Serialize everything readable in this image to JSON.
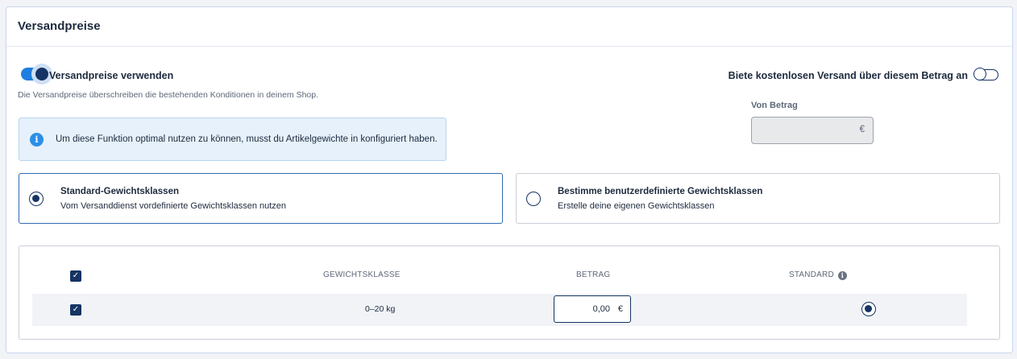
{
  "header": {
    "title": "Versandpreise"
  },
  "shipping_toggle": {
    "label": "Versandpreise verwenden",
    "description": "Die Versandpreise überschreiben die bestehenden Konditionen in deinem Shop.",
    "enabled": true
  },
  "info": {
    "icon": "info-icon",
    "text": "Um diese Funktion optimal nutzen zu können, musst du Artikelgewichte in konfiguriert haben."
  },
  "free_shipping": {
    "label": "Biete kostenlosen Versand über diesem Betrag an",
    "enabled": false,
    "from_label": "Von Betrag",
    "from_value": "",
    "currency": "€"
  },
  "weight_options": [
    {
      "title": "Standard-Gewichtsklassen",
      "description": "Vom Versanddienst vordefinierte Gewichtsklassen nutzen",
      "selected": true
    },
    {
      "title": "Bestimme benutzerdefinierte Gewichtsklassen",
      "description": "Erstelle deine eigenen Gewichtsklassen",
      "selected": false
    }
  ],
  "table": {
    "columns": {
      "weight": "GEWICHTSKLASSE",
      "amount": "BETRAG",
      "default": "STANDARD"
    },
    "header_checked": true,
    "rows": [
      {
        "checked": true,
        "weight": "0–20 kg",
        "amount": "0,00",
        "currency": "€",
        "default": true
      }
    ]
  },
  "colors": {
    "accent": "#1f7fe0",
    "navy": "#163463",
    "info_bg": "#e6f1fb"
  }
}
